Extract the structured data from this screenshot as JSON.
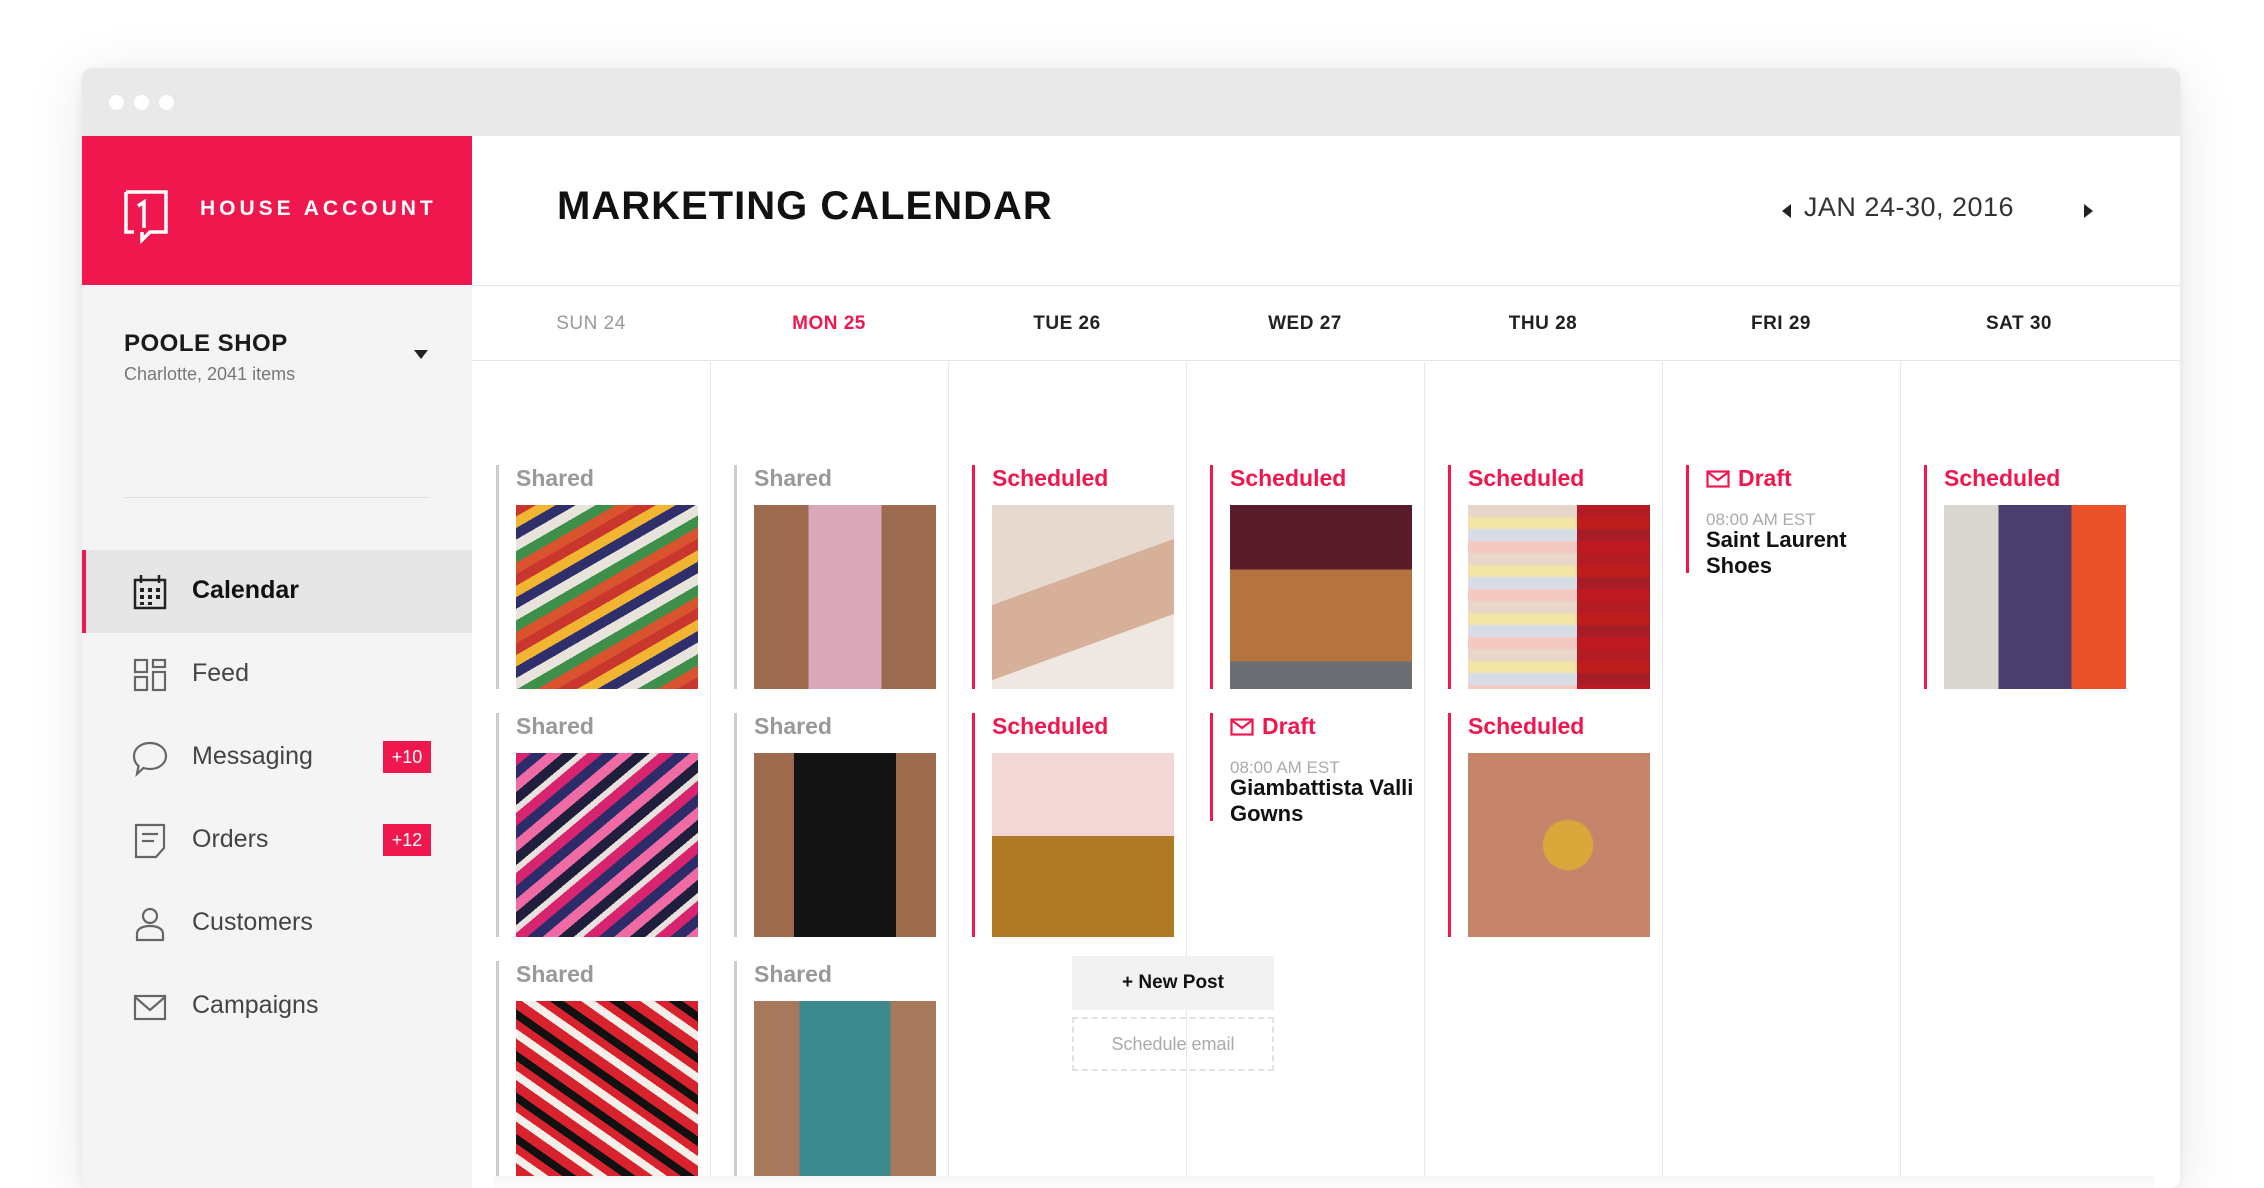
{
  "app": {
    "brand_name": "HOUSE ACCOUNT",
    "accent_color": "#f0174f"
  },
  "shop": {
    "name": "POOLE SHOP",
    "subtitle": "Charlotte, 2041 items"
  },
  "sidebar": {
    "items": [
      {
        "label": "Calendar",
        "icon": "calendar-icon",
        "active": true
      },
      {
        "label": "Feed",
        "icon": "feed-grid-icon"
      },
      {
        "label": "Messaging",
        "icon": "chat-bubble-icon",
        "badge": "+10"
      },
      {
        "label": "Orders",
        "icon": "document-icon",
        "badge": "+12"
      },
      {
        "label": "Customers",
        "icon": "user-icon"
      },
      {
        "label": "Campaigns",
        "icon": "mail-icon"
      }
    ]
  },
  "header": {
    "title": "MARKETING CALENDAR",
    "date_range": "JAN 24-30, 2016"
  },
  "days": [
    {
      "label": "SUN 24",
      "state": "past"
    },
    {
      "label": "MON 25",
      "state": "today"
    },
    {
      "label": "TUE 26",
      "state": "upcoming"
    },
    {
      "label": "WED 27",
      "state": "upcoming"
    },
    {
      "label": "THU 28",
      "state": "upcoming"
    },
    {
      "label": "FRI 29",
      "state": "upcoming"
    },
    {
      "label": "SAT 30",
      "state": "upcoming"
    }
  ],
  "posts": {
    "sun": [
      {
        "status": "Shared",
        "thumb": "zigzag tote bag photo"
      },
      {
        "status": "Shared",
        "thumb": "pink zigzag tote bag photo"
      },
      {
        "status": "Shared",
        "thumb": "red zigzag woven bag photo"
      }
    ],
    "mon": [
      {
        "status": "Shared",
        "thumb": "floral maxi dress photo"
      },
      {
        "status": "Shared",
        "thumb": "black floral tunic photo"
      },
      {
        "status": "Shared",
        "thumb": "printed sleeveless top photo"
      }
    ],
    "tue": [
      {
        "status": "Scheduled",
        "thumb": "studded sandals photo"
      },
      {
        "status": "Scheduled",
        "thumb": "platform sandals photo"
      }
    ],
    "wed": [
      {
        "status": "Scheduled",
        "thumb": "fringe leather bag photo"
      },
      {
        "status": "Draft",
        "time": "08:00 AM EST",
        "title": "Giambattista Valli Gowns"
      }
    ],
    "thu": [
      {
        "status": "Scheduled",
        "thumb": "folded fringe scarves photo"
      },
      {
        "status": "Scheduled",
        "thumb": "gold hoop earring photo"
      }
    ],
    "fri": [
      {
        "status": "Draft",
        "time": "08:00 AM EST",
        "title": "Saint Laurent Shoes"
      }
    ],
    "sat": [
      {
        "status": "Scheduled",
        "thumb": "printed gown photo"
      }
    ]
  },
  "actions": {
    "new_post": "+ New Post",
    "schedule_email": "Schedule email"
  }
}
